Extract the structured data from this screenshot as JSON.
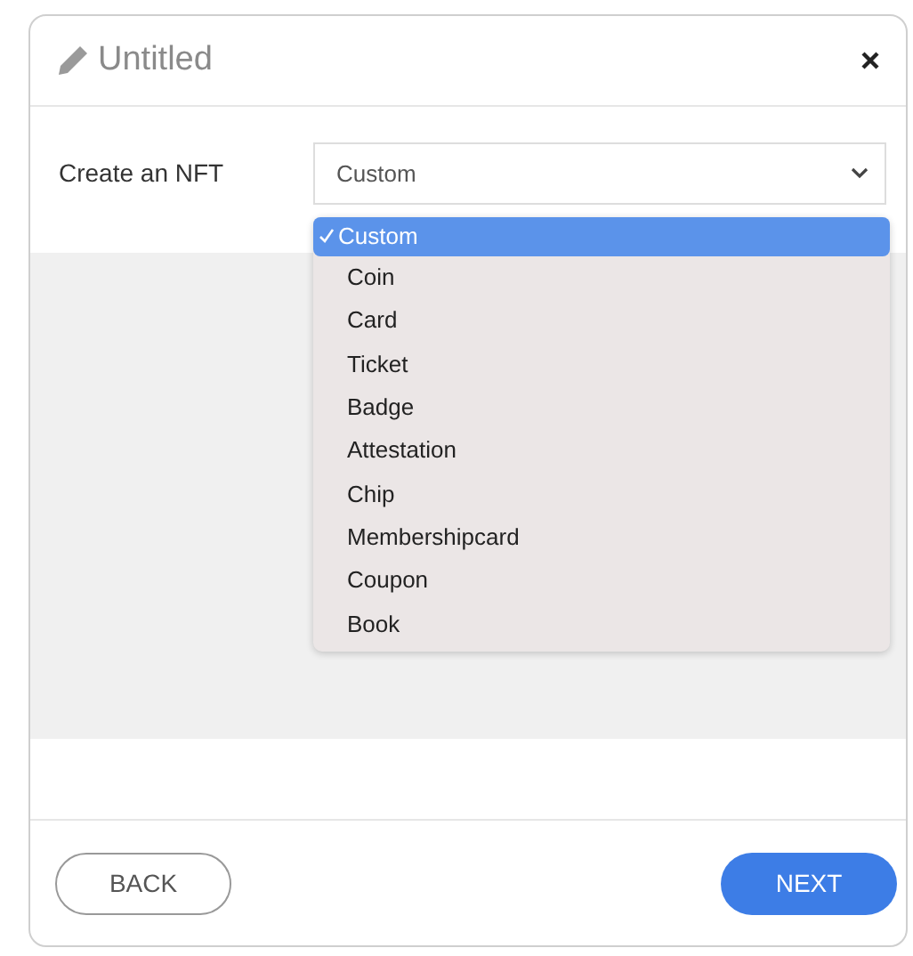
{
  "window": {
    "title": "Untitled"
  },
  "form": {
    "label": "Create an NFT",
    "select": {
      "value": "Custom",
      "expanded": true,
      "options": [
        {
          "label": "Custom",
          "selected": true
        },
        {
          "label": "Coin",
          "selected": false
        },
        {
          "label": "Card",
          "selected": false
        },
        {
          "label": "Ticket",
          "selected": false
        },
        {
          "label": "Badge",
          "selected": false
        },
        {
          "label": "Attestation",
          "selected": false
        },
        {
          "label": "Chip",
          "selected": false
        },
        {
          "label": "Membershipcard",
          "selected": false
        },
        {
          "label": "Coupon",
          "selected": false
        },
        {
          "label": "Book",
          "selected": false
        }
      ]
    }
  },
  "buttons": [
    {
      "label": "BACK",
      "kind": "secondary"
    },
    {
      "label": "NEXT",
      "kind": "primary"
    }
  ]
}
